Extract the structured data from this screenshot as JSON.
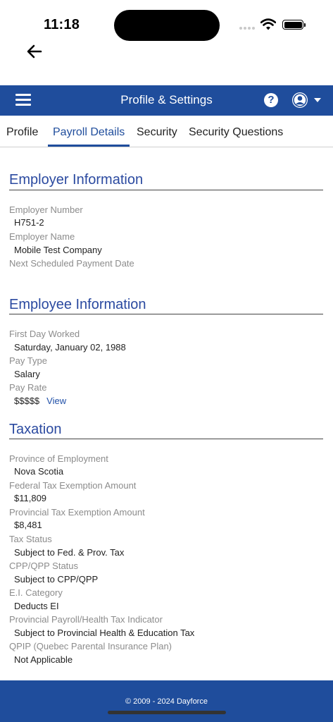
{
  "status_bar": {
    "time": "11:18",
    "icons": [
      "signal-dots-icon",
      "wifi-icon",
      "battery-icon"
    ]
  },
  "nav": {
    "back_icon": "arrow-left-icon"
  },
  "header": {
    "title": "Profile & Settings",
    "menu_icon": "hamburger-menu-icon",
    "help_icon": "?",
    "account_icon": "user-circle-icon",
    "dropdown_icon": "caret-down-icon",
    "bg_color": "#1f4d9c"
  },
  "tabs": [
    {
      "label": "Profile",
      "active": false
    },
    {
      "label": "Payroll Details",
      "active": true
    },
    {
      "label": "Security",
      "active": false
    },
    {
      "label": "Security Questions",
      "active": false
    }
  ],
  "employer": {
    "title": "Employer Information",
    "fields": [
      {
        "label": "Employer Number",
        "value": "H751-2"
      },
      {
        "label": "Employer Name",
        "value": "Mobile Test Company"
      },
      {
        "label": "Next Scheduled Payment Date",
        "value": ""
      }
    ]
  },
  "employee": {
    "title": "Employee Information",
    "fields": [
      {
        "label": "First Day Worked",
        "value": "Saturday, January 02, 1988"
      },
      {
        "label": "Pay Type",
        "value": "Salary"
      },
      {
        "label": "Pay Rate",
        "value": "$$$$$",
        "link": "View"
      }
    ]
  },
  "taxation": {
    "title": "Taxation",
    "fields": [
      {
        "label": "Province of Employment",
        "value": "Nova Scotia"
      },
      {
        "label": "Federal Tax Exemption Amount",
        "value": "$11,809"
      },
      {
        "label": "Provincial Tax Exemption Amount",
        "value": "$8,481"
      },
      {
        "label": "Tax Status",
        "value": "Subject to Fed. & Prov. Tax"
      },
      {
        "label": "CPP/QPP Status",
        "value": "Subject to CPP/QPP"
      },
      {
        "label": "E.I. Category",
        "value": "Deducts EI"
      },
      {
        "label": "Provincial Payroll/Health Tax Indicator",
        "value": "Subject to Provincial Health & Education Tax"
      },
      {
        "label": "QPIP (Quebec Parental Insurance Plan)",
        "value": "Not Applicable"
      }
    ]
  },
  "footer": {
    "copyright": "© 2009 - 2024 Dayforce"
  },
  "colors": {
    "accent": "#1f4d9c",
    "section_title": "#2b4aa0",
    "label": "#8c8c8c"
  }
}
